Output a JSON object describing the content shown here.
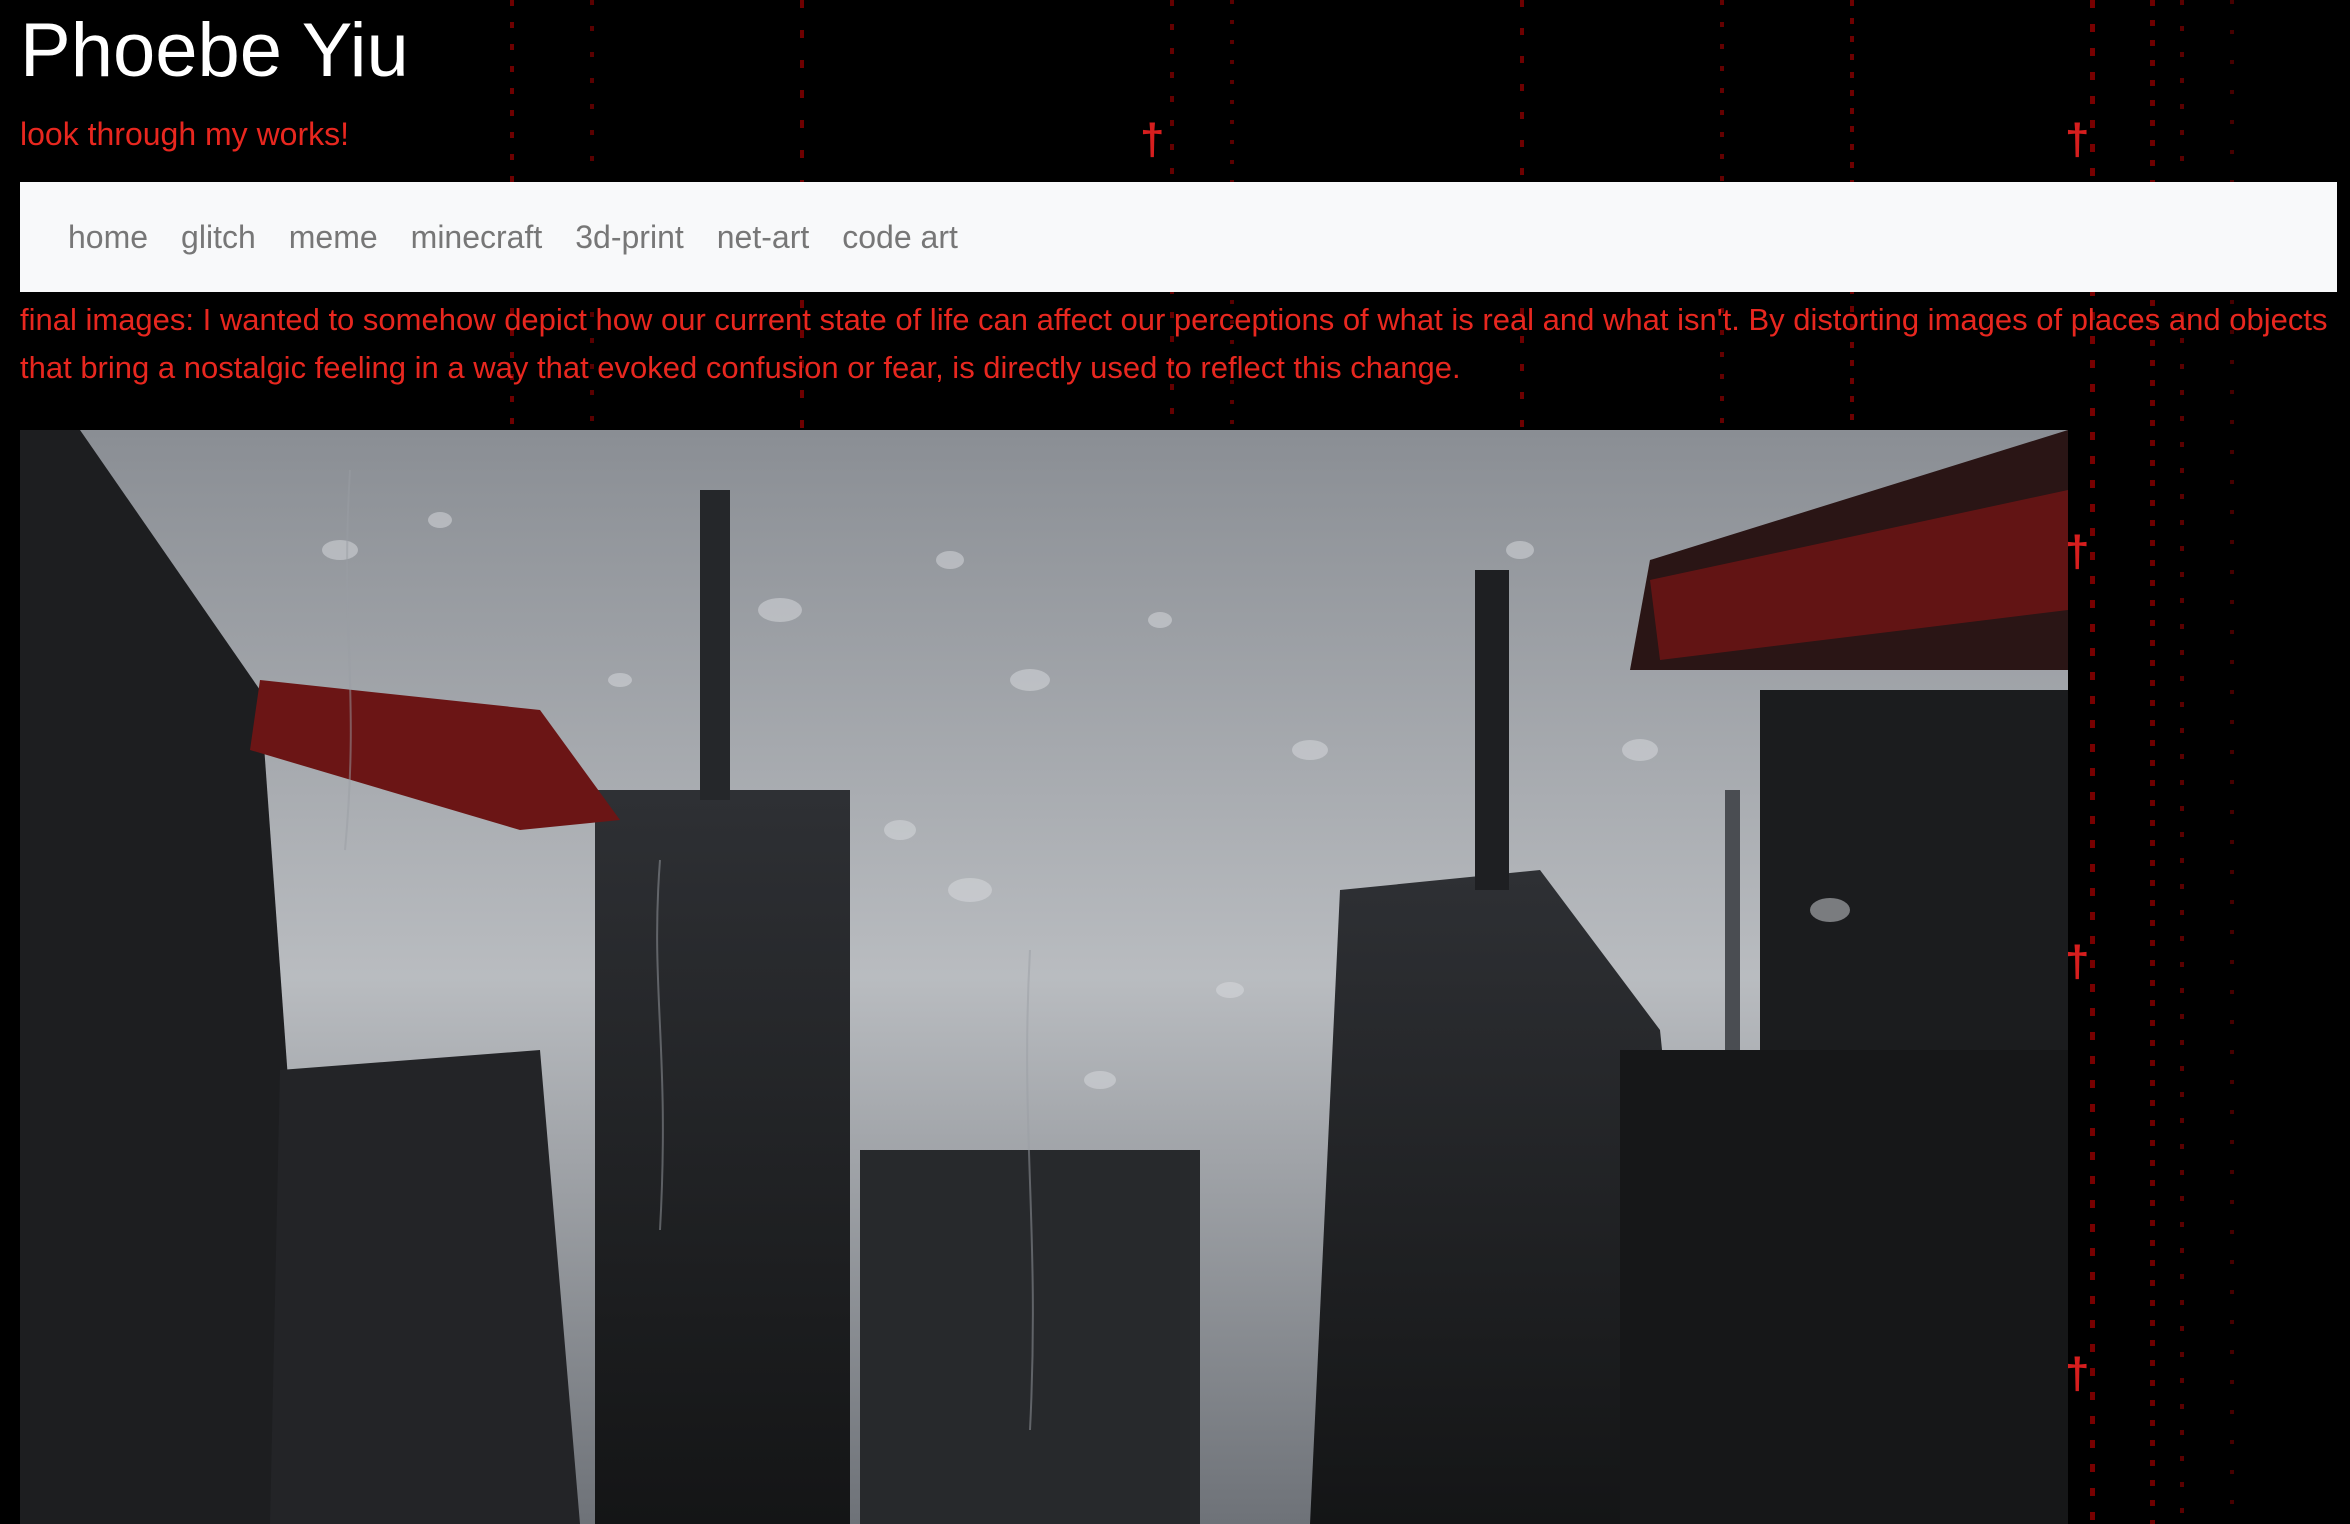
{
  "header": {
    "title": "Phoebe Yiu",
    "tagline": "look through my works!"
  },
  "nav": {
    "items": [
      {
        "label": "home"
      },
      {
        "label": "glitch"
      },
      {
        "label": "meme"
      },
      {
        "label": "minecraft"
      },
      {
        "label": "3d-print"
      },
      {
        "label": "net-art"
      },
      {
        "label": "code art"
      }
    ]
  },
  "main": {
    "description": "final images: I wanted to somehow depict how our current state of life can affect our perceptions of what is real and what isn't. By distorting images of places and objects that bring a nostalgic feeling in a way that evoked confusion or fear, is directly used to reflect this change."
  },
  "colors": {
    "background": "#000000",
    "accent_red": "#e8271f",
    "title_white": "#ffffff",
    "navbar_bg": "#f8f9fa",
    "nav_text": "#777777"
  },
  "icons": {
    "background_symbol": "cross-icon"
  }
}
